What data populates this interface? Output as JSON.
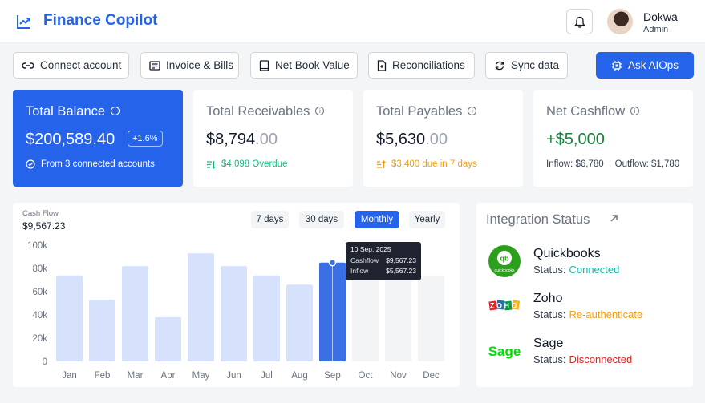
{
  "app": {
    "title": "Finance Copilot"
  },
  "user": {
    "name": "Dokwa",
    "role": "Admin"
  },
  "actions": [
    {
      "label": "Connect account",
      "icon": "link-icon"
    },
    {
      "label": "Invoice & Bills",
      "icon": "receipt-icon"
    },
    {
      "label": "Net Book Value",
      "icon": "book-icon"
    },
    {
      "label": "Reconciliations",
      "icon": "document-icon"
    },
    {
      "label": "Sync data",
      "icon": "refresh-icon"
    },
    {
      "label": "Ask AIOps",
      "icon": "chip-icon"
    }
  ],
  "cards": {
    "balance": {
      "title": "Total Balance",
      "amount": "$200,589.40",
      "badge": "+1.6%",
      "sub": "From 3 connected accounts"
    },
    "receivables": {
      "title": "Total Receivables",
      "amount_main": "$8,794",
      "amount_cents": ".00",
      "sub": "$4,098 Overdue",
      "sub_color": "#10b981"
    },
    "payables": {
      "title": "Total Payables",
      "amount_main": "$5,630",
      "amount_cents": ".00",
      "sub": "$3,400 due in 7 days",
      "sub_color": "#f59e0b"
    },
    "cashflow": {
      "title": "Net Cashflow",
      "amount": "+$5,000",
      "amount_color": "#15803d",
      "inflow_label": "Inflow:",
      "inflow": "$6,780",
      "outflow_label": "Outflow:",
      "outflow": "$1,780"
    }
  },
  "cashflow_panel": {
    "label": "Cash Flow",
    "value": "$9,567.23",
    "ranges": [
      "7 days",
      "30 days",
      "Monthly",
      "Yearly"
    ],
    "active_range": "Monthly",
    "tooltip": {
      "date": "10 Sep, 2025",
      "cashflow_label": "Cashflow",
      "cashflow": "$9,567.23",
      "inflow_label": "Inflow",
      "inflow": "$5,567.23"
    }
  },
  "chart_data": {
    "type": "bar",
    "categories": [
      "Jan",
      "Feb",
      "Mar",
      "Apr",
      "May",
      "Jun",
      "Jul",
      "Aug",
      "Sep",
      "Oct",
      "Nov",
      "Dec"
    ],
    "values": [
      74,
      53,
      82,
      38,
      93,
      82,
      74,
      66,
      85,
      null,
      null,
      null
    ],
    "future_placeholder": 74,
    "highlight": "Sep",
    "yticks": [
      "0",
      "20k",
      "40k",
      "60k",
      "80k",
      "100k"
    ],
    "ylim": [
      0,
      100
    ],
    "colors": {
      "bar": "#d6e2fb",
      "highlight": "#3b6fe6",
      "future": "#f3f4f6"
    }
  },
  "integrations": {
    "title": "Integration Status",
    "status_label": "Status:",
    "items": [
      {
        "name": "Quickbooks",
        "status": "Connected",
        "color": "#14b8a6",
        "logo_text": "quickbooks"
      },
      {
        "name": "Zoho",
        "status": "Re-authenticate",
        "color": "#f59e0b",
        "logo_text": "ZOHO"
      },
      {
        "name": "Sage",
        "status": "Disconnected",
        "color": "#dc2626",
        "logo_text": "Sage"
      }
    ]
  }
}
